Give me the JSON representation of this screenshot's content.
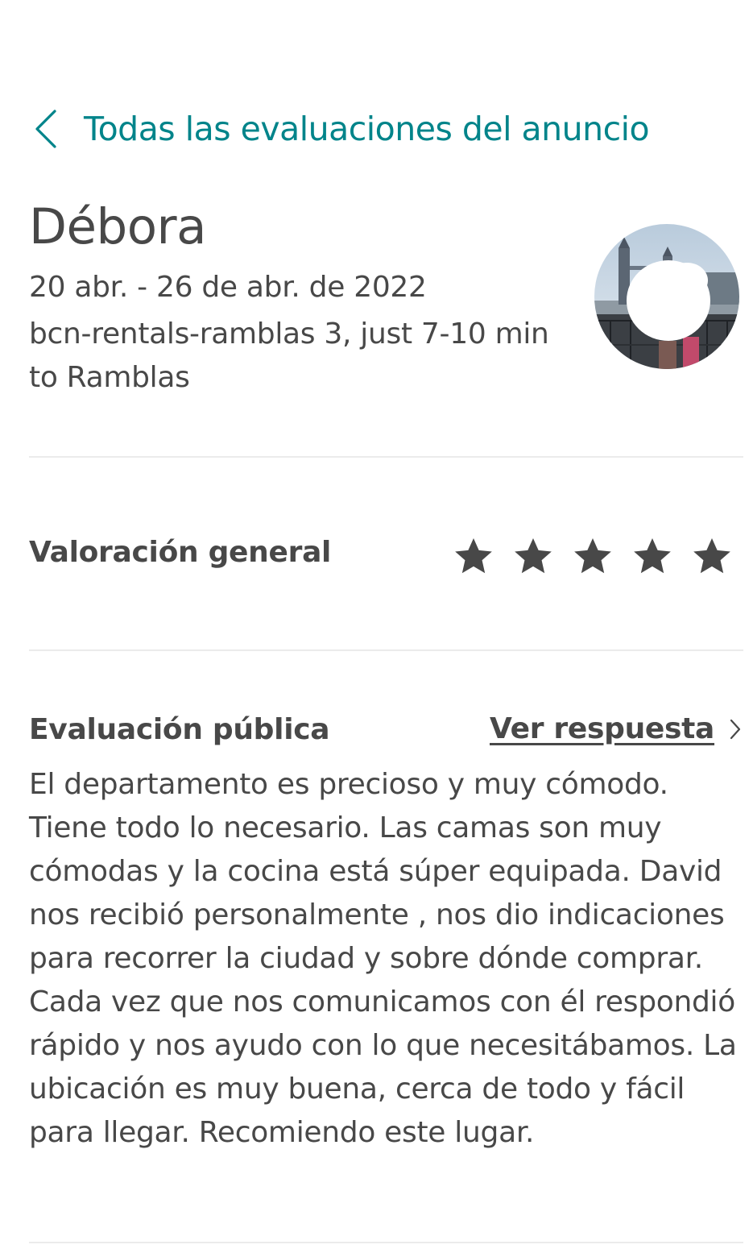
{
  "header": {
    "back_label": "Todas las evaluaciones del anuncio"
  },
  "reviewer": {
    "name": "Débora",
    "dates": "20 abr. - 26 de abr. de 2022",
    "listing": "bcn-rentals-ramblas 3, just 7-10 min to Ramblas"
  },
  "rating": {
    "label": "Valoración general",
    "stars": 5,
    "max": 5
  },
  "public_review": {
    "label": "Evaluación pública",
    "reply_link": "Ver respuesta",
    "body": "El departamento es precioso y muy cómodo. Tiene todo lo necesario. Las camas son muy cómodas y la cocina está súper equipada. David nos recibió personalmente , nos dio indicaciones para recorrer la ciudad y sobre dónde comprar. Cada vez que nos comunicamos con él respondió rápido y nos ayudo con lo que necesitábamos. La ubicación es muy buena, cerca de todo y fácil para llegar. Recomiendo este lugar."
  },
  "colors": {
    "accent": "#00848a",
    "text": "#484848",
    "divider": "#ebebeb"
  }
}
